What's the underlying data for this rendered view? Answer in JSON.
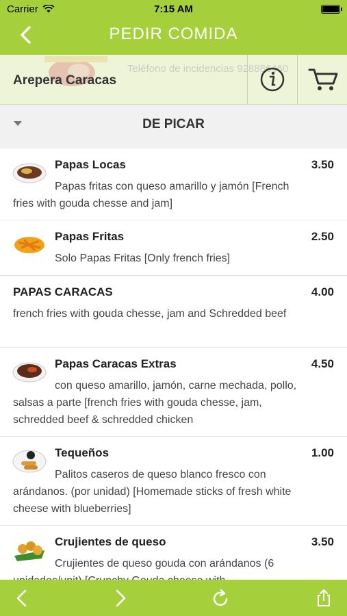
{
  "status_bar": {
    "carrier": "Carrier",
    "time": "7:15 AM",
    "wifi_icon": "wifi-icon",
    "battery_icon": "battery-icon"
  },
  "header": {
    "title": "PEDIR COMIDA",
    "back_icon": "chevron-left-icon",
    "background": "#a6cf3c"
  },
  "restaurant": {
    "name": "Arepera Caracas",
    "watermark_phone": "Teléfono de incidencias 928886460",
    "info_icon": "info-icon",
    "cart_icon": "cart-icon"
  },
  "section": {
    "title": "DE PICAR",
    "expanded": true
  },
  "items": [
    {
      "name": "Papas Locas",
      "price": "3.50",
      "description": "Papas fritas con queso amarillo y jamón [French fries with gouda chesse and jam]",
      "has_image": true
    },
    {
      "name": "Papas Fritas",
      "price": "2.50",
      "description": "Solo Papas Fritas [Only french fries]",
      "has_image": true
    },
    {
      "name": "PAPAS CARACAS",
      "price": "4.00",
      "description": "french fries with gouda chesse, jam and Schredded beef",
      "has_image": false
    },
    {
      "name": "Papas Caracas Extras",
      "price": "4.50",
      "description": "con queso amarillo, jamón, carne mechada, pollo, salsas a parte [french fries with gouda chesse, jam, schredded beef & schredded chicken",
      "has_image": true
    },
    {
      "name": "Tequeños",
      "price": "1.00",
      "description": "Palitos caseros de queso blanco fresco con arándanos. (por unidad) [Homemade sticks of fresh white cheese with blueberries]",
      "has_image": true
    },
    {
      "name": "Crujientes de queso",
      "price": "3.50",
      "description": "Crujientes de queso gouda con arándanos (6 unidades/unit) [Crunchy Gouda cheese with",
      "has_image": true
    }
  ],
  "toolbar": {
    "back_icon": "chevron-left-icon",
    "forward_icon": "chevron-right-icon",
    "reload_icon": "reload-icon",
    "share_icon": "share-icon",
    "color": "#a6cf3c"
  }
}
